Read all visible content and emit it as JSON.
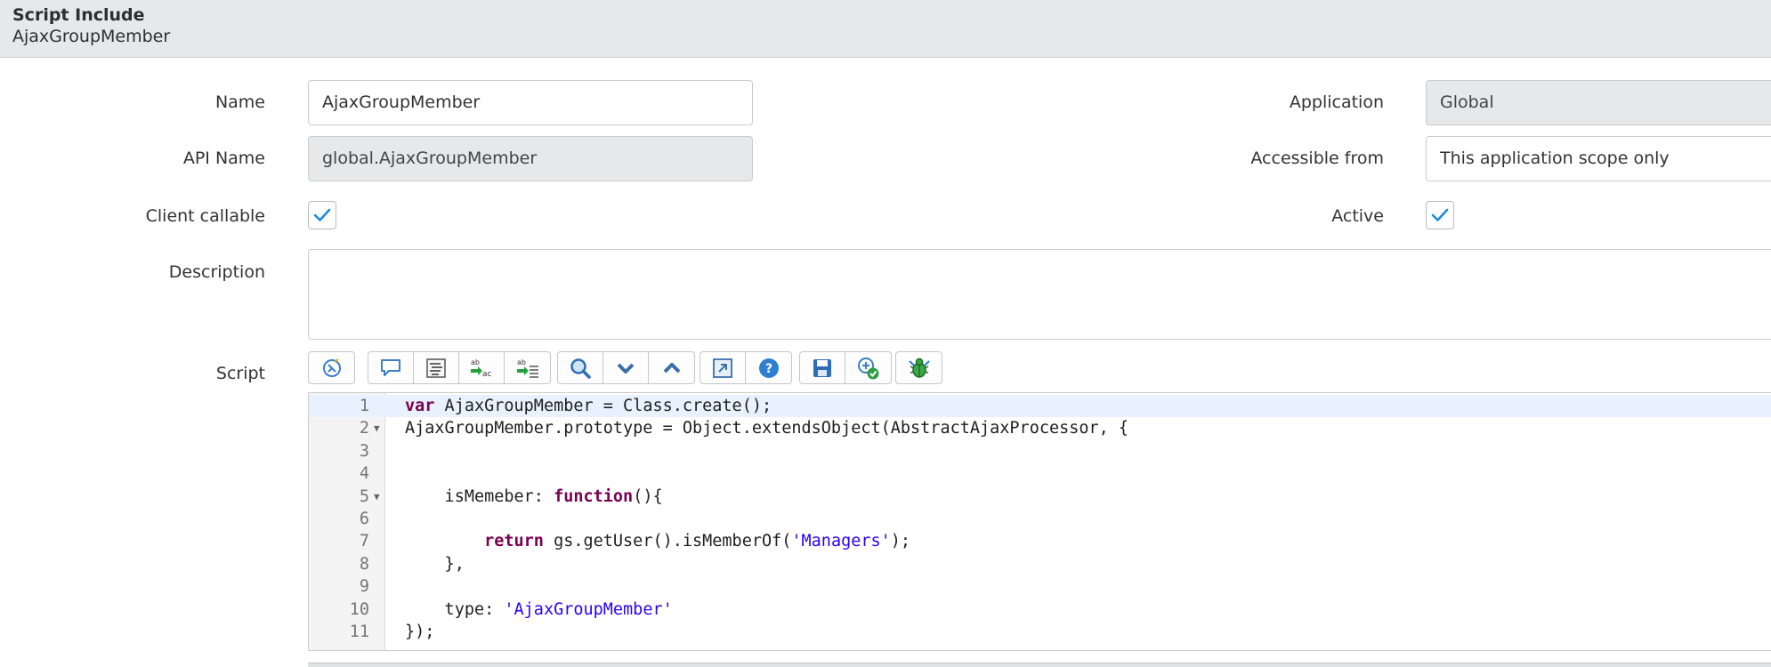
{
  "header": {
    "title": "Script Include",
    "record_name": "AjaxGroupMember"
  },
  "form": {
    "name": {
      "label": "Name",
      "value": "AjaxGroupMember"
    },
    "api_name": {
      "label": "API Name",
      "value": "global.AjaxGroupMember"
    },
    "client_callable": {
      "label": "Client callable",
      "checked": true
    },
    "description": {
      "label": "Description",
      "value": ""
    },
    "script": {
      "label": "Script"
    },
    "application": {
      "label": "Application",
      "value": "Global"
    },
    "accessible_from": {
      "label": "Accessible from",
      "value": "This application scope only"
    },
    "active": {
      "label": "Active",
      "checked": true
    }
  },
  "toolbar": {
    "groups": [
      [
        "format-code-icon"
      ],
      [
        "comment-icon",
        "format-block-icon",
        "replace-icon",
        "replace-all-icon"
      ],
      [
        "search-icon",
        "next-icon",
        "previous-icon"
      ],
      [
        "fullscreen-icon",
        "help-icon"
      ],
      [
        "save-icon",
        "syntax-check-icon"
      ],
      [
        "debug-icon"
      ]
    ]
  },
  "colors": {
    "accent": "#1f8ae0",
    "header_bg": "#e6e8ea",
    "keyword": "#7b0052",
    "string": "#2a00ff",
    "active_line": "#e8f2fe"
  },
  "script": {
    "lines": [
      {
        "n": "1",
        "fold": false,
        "segments": [
          {
            "t": "var",
            "c": "kw"
          },
          {
            "t": " AjaxGroupMember = Class.create();"
          }
        ]
      },
      {
        "n": "2",
        "fold": true,
        "segments": [
          {
            "t": "AjaxGroupMember.prototype = Object.extendsObject(AbstractAjaxProcessor, {"
          }
        ]
      },
      {
        "n": "3",
        "fold": false,
        "segments": []
      },
      {
        "n": "4",
        "fold": false,
        "segments": []
      },
      {
        "n": "5",
        "fold": true,
        "segments": [
          {
            "t": "    isMemeber: "
          },
          {
            "t": "function",
            "c": "kw"
          },
          {
            "t": "(){"
          }
        ]
      },
      {
        "n": "6",
        "fold": false,
        "segments": []
      },
      {
        "n": "7",
        "fold": false,
        "segments": [
          {
            "t": "        "
          },
          {
            "t": "return",
            "c": "kw"
          },
          {
            "t": " gs.getUser().isMemberOf("
          },
          {
            "t": "'Managers'",
            "c": "str"
          },
          {
            "t": ");"
          }
        ]
      },
      {
        "n": "8",
        "fold": false,
        "segments": [
          {
            "t": "    },"
          }
        ]
      },
      {
        "n": "9",
        "fold": false,
        "segments": []
      },
      {
        "n": "10",
        "fold": false,
        "segments": [
          {
            "t": "    type: "
          },
          {
            "t": "'AjaxGroupMember'",
            "c": "str"
          }
        ]
      },
      {
        "n": "11",
        "fold": false,
        "segments": [
          {
            "t": "});"
          }
        ]
      }
    ]
  }
}
